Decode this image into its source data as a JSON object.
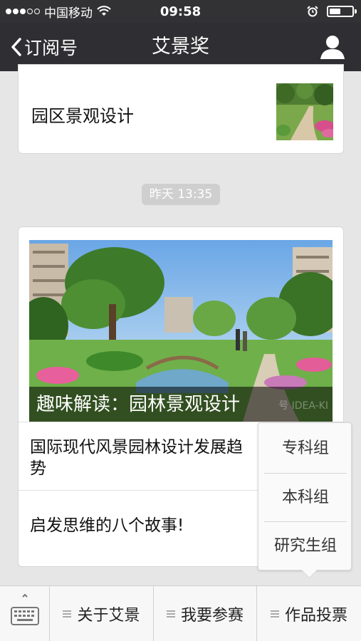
{
  "status_bar": {
    "carrier": "中国移动",
    "time": "09:58",
    "battery_level": 0.5,
    "signal_bars": 3,
    "signal_total": 5,
    "icons": [
      "signal-dots-icon",
      "wifi-icon",
      "alarm-clock-icon",
      "battery-icon"
    ]
  },
  "nav": {
    "back_label": "订阅号",
    "title": "艾景奖",
    "back_icon": "chevron-left-icon",
    "profile_icon": "person-icon"
  },
  "messages": [
    {
      "type": "single",
      "title": "园区景观设计",
      "thumbnail": "garden-path-image"
    }
  ],
  "timestamp": "昨天 13:35",
  "article_group": {
    "hero_caption": "趣味解读：园林景观设计",
    "hero_watermark": "号 IDEA-KI",
    "hero_image": "landscape-garden-image",
    "items": [
      {
        "title": "国际现代风景园林设计发展趋势"
      },
      {
        "title": "启发思维的八个故事!"
      }
    ]
  },
  "popup_menu": {
    "items": [
      "专科组",
      "本科组",
      "研究生组"
    ]
  },
  "bottom_menu": {
    "keyboard_icon": "keyboard-icon",
    "items": [
      "关于艾景",
      "我要参赛",
      "作品投票"
    ]
  },
  "colors": {
    "status_bar_bg": "#323235",
    "nav_bg": "#2f2f33",
    "page_bg": "#e6e6e6",
    "timestamp_bg": "#cfcfcf"
  }
}
